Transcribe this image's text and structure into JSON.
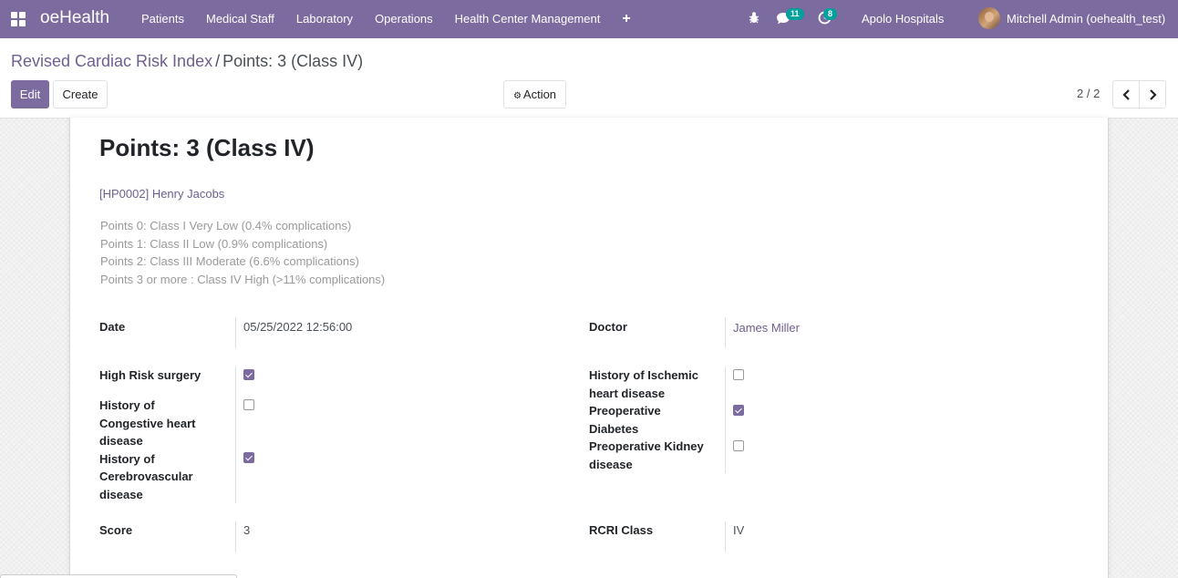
{
  "navbar": {
    "brand": "oeHealth",
    "menu": [
      "Patients",
      "Medical Staff",
      "Laboratory",
      "Operations",
      "Health Center Management"
    ],
    "plus_icon": "+",
    "chat_count": "11",
    "activity_count": "8",
    "company": "Apolo Hospitals",
    "user": "Mitchell Admin (oehealth_test)",
    "accent_color": "#7c6b9e",
    "badge_color": "#00a09d"
  },
  "breadcrumb": {
    "parent": "Revised Cardiac Risk Index",
    "separator": "/",
    "current": "Points: 3 (Class IV)"
  },
  "toolbar": {
    "edit_label": "Edit",
    "create_label": "Create",
    "action_label": "Action",
    "pager": "2 / 2"
  },
  "form": {
    "title": "Points: 3 (Class IV)",
    "patient": "[HP0002] Henry Jacobs",
    "class_info": [
      "Points 0: Class I Very Low (0.4% complications)",
      "Points 1: Class II Low (0.9% complications)",
      "Points 2: Class III Moderate (6.6% complications)",
      "Points 3 or more : Class IV High (>11% complications)"
    ],
    "date_label": "Date",
    "date_value": "05/25/2022 12:56:00",
    "doctor_label": "Doctor",
    "doctor_value": "James Miller",
    "high_risk_label": "High Risk surgery",
    "high_risk_checked": true,
    "chf_label_1": "History of",
    "chf_label_2": "Congestive heart",
    "chf_label_3": "disease",
    "chf_checked": false,
    "cvd_label_1": "History of",
    "cvd_label_2": "Cerebrovascular",
    "cvd_label_3": "disease",
    "cvd_checked": true,
    "ihd_label_1": "History of Ischemic",
    "ihd_label_2": "heart disease",
    "ihd_checked": false,
    "diabetes_label_1": "Preoperative",
    "diabetes_label_2": "Diabetes",
    "diabetes_checked": true,
    "kidney_label_1": "Preoperative Kidney",
    "kidney_label_2": "disease",
    "kidney_checked": false,
    "score_label": "Score",
    "score_value": "3",
    "rcri_label": "RCRI Class",
    "rcri_value": "IV"
  }
}
